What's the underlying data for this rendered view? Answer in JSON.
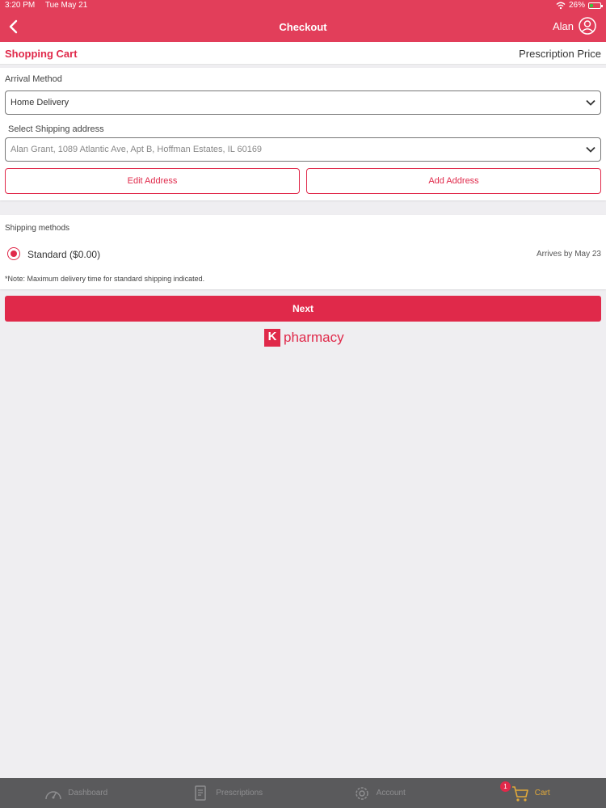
{
  "status_bar": {
    "time": "3:20 PM",
    "date": "Tue May 21",
    "battery": "26%"
  },
  "nav": {
    "title": "Checkout",
    "user": "Alan"
  },
  "subheader": {
    "left": "Shopping Cart",
    "right": "Prescription Price"
  },
  "arrival": {
    "label": "Arrival Method",
    "value": "Home Delivery"
  },
  "shipping_address": {
    "label": "Select Shipping address",
    "value": "Alan Grant, 1089 Atlantic Ave, Apt B,  Hoffman Estates, IL 60169"
  },
  "buttons": {
    "edit": "Edit Address",
    "add": "Add Address",
    "next": "Next"
  },
  "shipping_methods": {
    "label": "Shipping methods",
    "option": "Standard ($0.00)",
    "arrives": "Arrives by May 23",
    "note": "*Note: Maximum delivery time for standard shipping indicated."
  },
  "logo": {
    "mark": "K",
    "text": "pharmacy"
  },
  "tabs": [
    {
      "label": "Dashboard",
      "icon": "speedometer-icon"
    },
    {
      "label": "Prescriptions",
      "icon": "prescription-icon"
    },
    {
      "label": "Account",
      "icon": "gear-icon"
    },
    {
      "label": "Cart",
      "icon": "cart-icon"
    }
  ],
  "cart_badge": "1",
  "colors": {
    "brand": "#e0294a",
    "header": "#e23e5a",
    "active_tab": "#e1a93a"
  }
}
